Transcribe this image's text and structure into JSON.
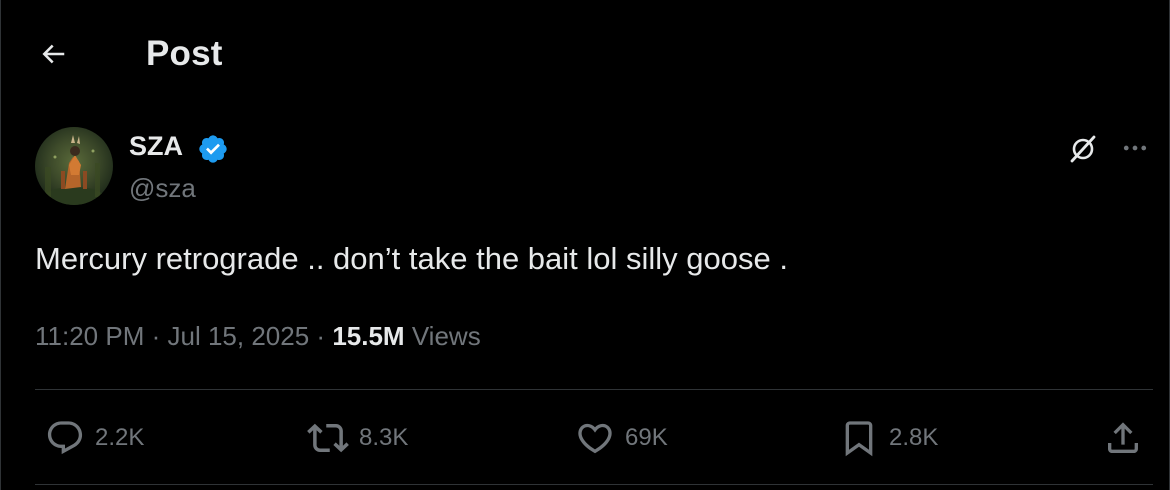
{
  "header": {
    "title": "Post",
    "back_icon": "arrow-left-icon"
  },
  "author": {
    "display_name": "SZA",
    "handle": "@sza",
    "verified": true,
    "verified_color": "#1d9bf0"
  },
  "post": {
    "text": "Mercury retrograde .. don’t take the bait lol silly goose .",
    "time": "11:20 PM",
    "separator": "·",
    "date": "Jul 15, 2025",
    "views_count": "15.5M",
    "views_label": "Views"
  },
  "actions": {
    "replies": "2.2K",
    "reposts": "8.3K",
    "likes": "69K",
    "bookmarks": "2.8K"
  },
  "colors": {
    "background": "#000000",
    "text_primary": "#e7e9ea",
    "text_secondary": "#71767b",
    "divider": "#2f3336"
  }
}
